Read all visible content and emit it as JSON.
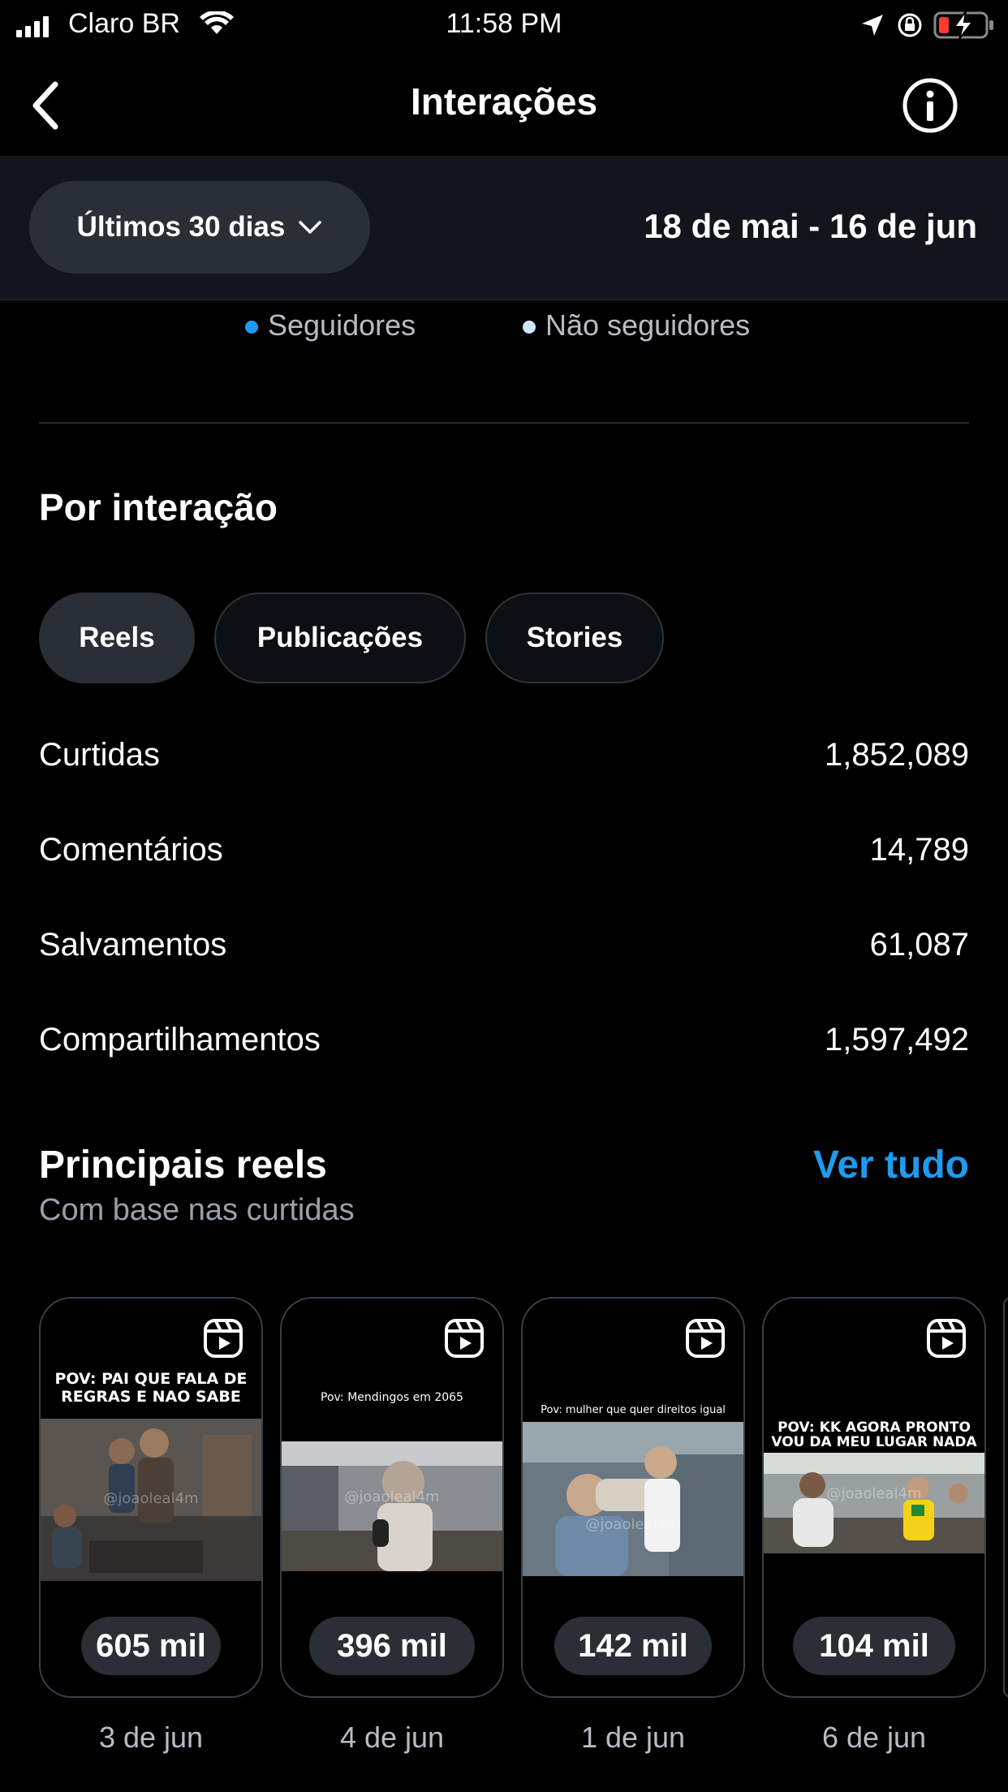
{
  "status": {
    "carrier": "Claro BR",
    "time": "11:58 PM"
  },
  "nav": {
    "title": "Interações"
  },
  "filter": {
    "range_label": "Últimos 30 dias",
    "date_range": "18 de mai - 16 de jun"
  },
  "legend": {
    "followers": "Seguidores",
    "non_followers": "Não seguidores",
    "followers_color": "#1d9bf0",
    "non_followers_color": "#cfe6ff"
  },
  "by_interaction": {
    "title": "Por interação",
    "tabs": [
      {
        "label": "Reels",
        "active": true
      },
      {
        "label": "Publicações",
        "active": false
      },
      {
        "label": "Stories",
        "active": false
      }
    ],
    "metrics": [
      {
        "label": "Curtidas",
        "value": "1,852,089"
      },
      {
        "label": "Comentários",
        "value": "14,789"
      },
      {
        "label": "Salvamentos",
        "value": "61,087"
      },
      {
        "label": "Compartilhamentos",
        "value": "1,597,492"
      }
    ]
  },
  "top_reels": {
    "title": "Principais reels",
    "subtitle": "Com base nas curtidas",
    "see_all": "Ver tudo",
    "items": [
      {
        "caption": "POV: PAI QUE FALA DE REGRAS E NAO SABE",
        "watermark": "@joaoleal4m",
        "count": "605 mil",
        "date": "3 de jun"
      },
      {
        "caption": "Pov: Mendingos em 2065",
        "watermark": "@joaoleal4m",
        "count": "396 mil",
        "date": "4 de jun"
      },
      {
        "caption": "Pov: mulher que quer direitos igual",
        "watermark": "@joaoleal4m",
        "count": "142 mil",
        "date": "1 de jun"
      },
      {
        "caption": "POV: KK AGORA PRONTO VOU DA MEU LUGAR NADA",
        "watermark": "@joaoleal4m",
        "count": "104 mil",
        "date": "6 de jun"
      }
    ]
  }
}
